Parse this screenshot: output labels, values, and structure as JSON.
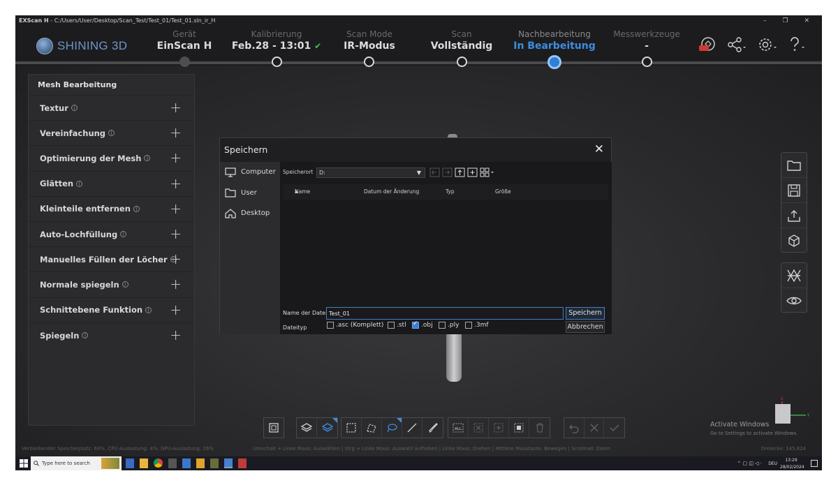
{
  "window": {
    "title_app": "EXScan H",
    "title_path": "C:/Users/User/Desktop/Scan_Test/Test_01/Test_01.sln_ir_H",
    "controls": "– ❐ ✕"
  },
  "brand": {
    "logo_text": "SHINING 3D",
    "accent": "#3d8de0"
  },
  "steps": [
    {
      "label": "Gerät",
      "value": "EinScan H"
    },
    {
      "label": "Kalibrierung",
      "value": "Feb.28 - 13:01",
      "check": "✔"
    },
    {
      "label": "Scan Mode",
      "value": "IR-Modus"
    },
    {
      "label": "Scan",
      "value": "Vollständig"
    },
    {
      "label": "Nachbearbeitung",
      "value": "In Bearbeitung"
    },
    {
      "label": "Messwerkzeuge",
      "value": "-"
    }
  ],
  "top_icons": [
    "new-icon",
    "share-icon",
    "settings-icon",
    "help-icon"
  ],
  "sidepanel": {
    "title": "Mesh Bearbeitung",
    "items": [
      {
        "label": "Textur"
      },
      {
        "label": "Vereinfachung"
      },
      {
        "label": "Optimierung der Mesh"
      },
      {
        "label": "Glätten"
      },
      {
        "label": "Kleinteile entfernen"
      },
      {
        "label": "Auto-Lochfüllung"
      },
      {
        "label": "Manuelles Füllen der Löcher"
      },
      {
        "label": "Normale spiegeln"
      },
      {
        "label": "Schnittebene Funktion"
      },
      {
        "label": "Spiegeln"
      }
    ],
    "info_glyph": "i",
    "plus_glyph": "+"
  },
  "dialog": {
    "title": "Speichern",
    "close": "✕",
    "places": [
      {
        "label": "Computer",
        "icon": "computer-icon"
      },
      {
        "label": "User",
        "icon": "folder-icon"
      },
      {
        "label": "Desktop",
        "icon": "home-icon"
      }
    ],
    "location_label": "Speicherort",
    "location_value": "D:",
    "columns": [
      "Name",
      "Datum der Änderung",
      "Typ",
      "Größe"
    ],
    "filename_label": "Name der Datei",
    "filename_value": "Test_01",
    "filetype_label": "Dateityp",
    "filetypes": [
      {
        "label": ".asc (Komplett)",
        "checked": false
      },
      {
        "label": ".stl",
        "checked": false
      },
      {
        "label": ".obj",
        "checked": true
      },
      {
        "label": ".ply",
        "checked": false
      },
      {
        "label": ".3mf",
        "checked": false
      }
    ],
    "save_button": "Speichern",
    "cancel_button": "Abbrechen"
  },
  "status": {
    "left": "Verbleibender Speicherplatz: 69%, CPU-Auslastung: 4%, GPU-Auslastung: 26%",
    "center": "Umschalt + Linke Maus: Auswählen | Strg + Linke Maus: Auswahl aufheben | Linke Maus: Drehen | Mittlere Maustaste: Bewegen | Scrollrad: Zoom",
    "right": "Dreiecke: 145,824"
  },
  "activate": {
    "title": "Activate Windows",
    "sub": "Go to Settings to activate Windows."
  },
  "taskbar": {
    "search_placeholder": "Type here to search",
    "lang": "DEU",
    "time": "13:29",
    "date": "28/02/2024"
  }
}
